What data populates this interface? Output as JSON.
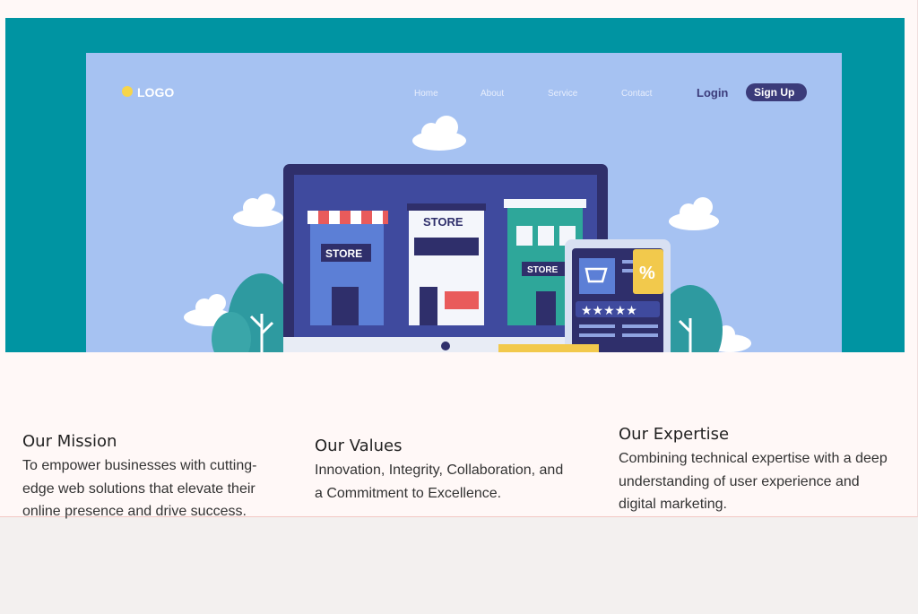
{
  "hero": {
    "logo": "LOGO",
    "nav": [
      "Home",
      "About",
      "Service",
      "Contact"
    ],
    "login": "Login",
    "signup": "Sign Up",
    "store_signs": [
      "STORE",
      "STORE",
      "STORE"
    ],
    "badge": "%",
    "rating_stars": 5,
    "colors": {
      "background": "#0094a2",
      "page": "#a6c2f2",
      "monitor": "#2f2f6b",
      "accent": "#f2c94c"
    }
  },
  "columns": [
    {
      "title": "Our Mission",
      "text": "To empower businesses with cutting-edge web solutions that elevate their online presence and drive success."
    },
    {
      "title": "Our Values",
      "text": "Innovation, Integrity, Collaboration, and a Commitment to Excellence."
    },
    {
      "title": "Our Expertise",
      "text": "Combining technical expertise with a deep understanding of user experience and digital marketing."
    }
  ]
}
